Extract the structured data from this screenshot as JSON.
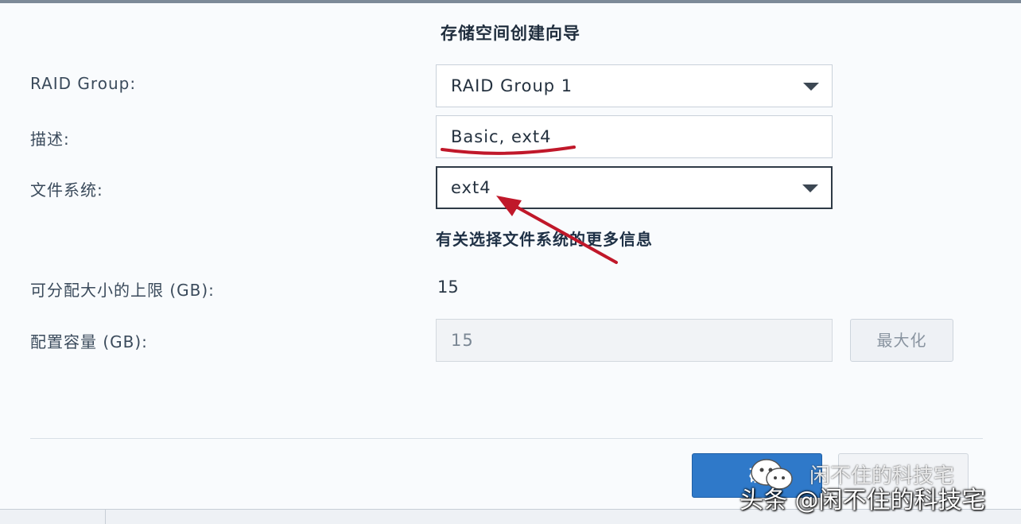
{
  "dialog": {
    "title": "存储空间创建向导"
  },
  "form": {
    "raid_group": {
      "label": "RAID Group:",
      "value": "RAID Group 1"
    },
    "description": {
      "label": "描述:",
      "value": "Basic, ext4"
    },
    "filesystem": {
      "label": "文件系统:",
      "value": "ext4"
    },
    "more_info_link": "有关选择文件系统的更多信息",
    "max_size": {
      "label": "可分配大小的上限 (GB):",
      "value": "15"
    },
    "capacity": {
      "label": "配置容量 (GB):",
      "value": "15",
      "maximize_label": "最大化"
    }
  },
  "footer": {
    "ok_label": "确"
  },
  "watermark": {
    "text": "头条 @闲不住的科技宅",
    "ghost_text": "闲不住的科技宅"
  },
  "colors": {
    "primary_button": "#2f79c9",
    "annotation_red": "#c0182a"
  },
  "icons": {
    "dropdown": "chevron-down-icon",
    "wechat": "wechat-icon"
  }
}
